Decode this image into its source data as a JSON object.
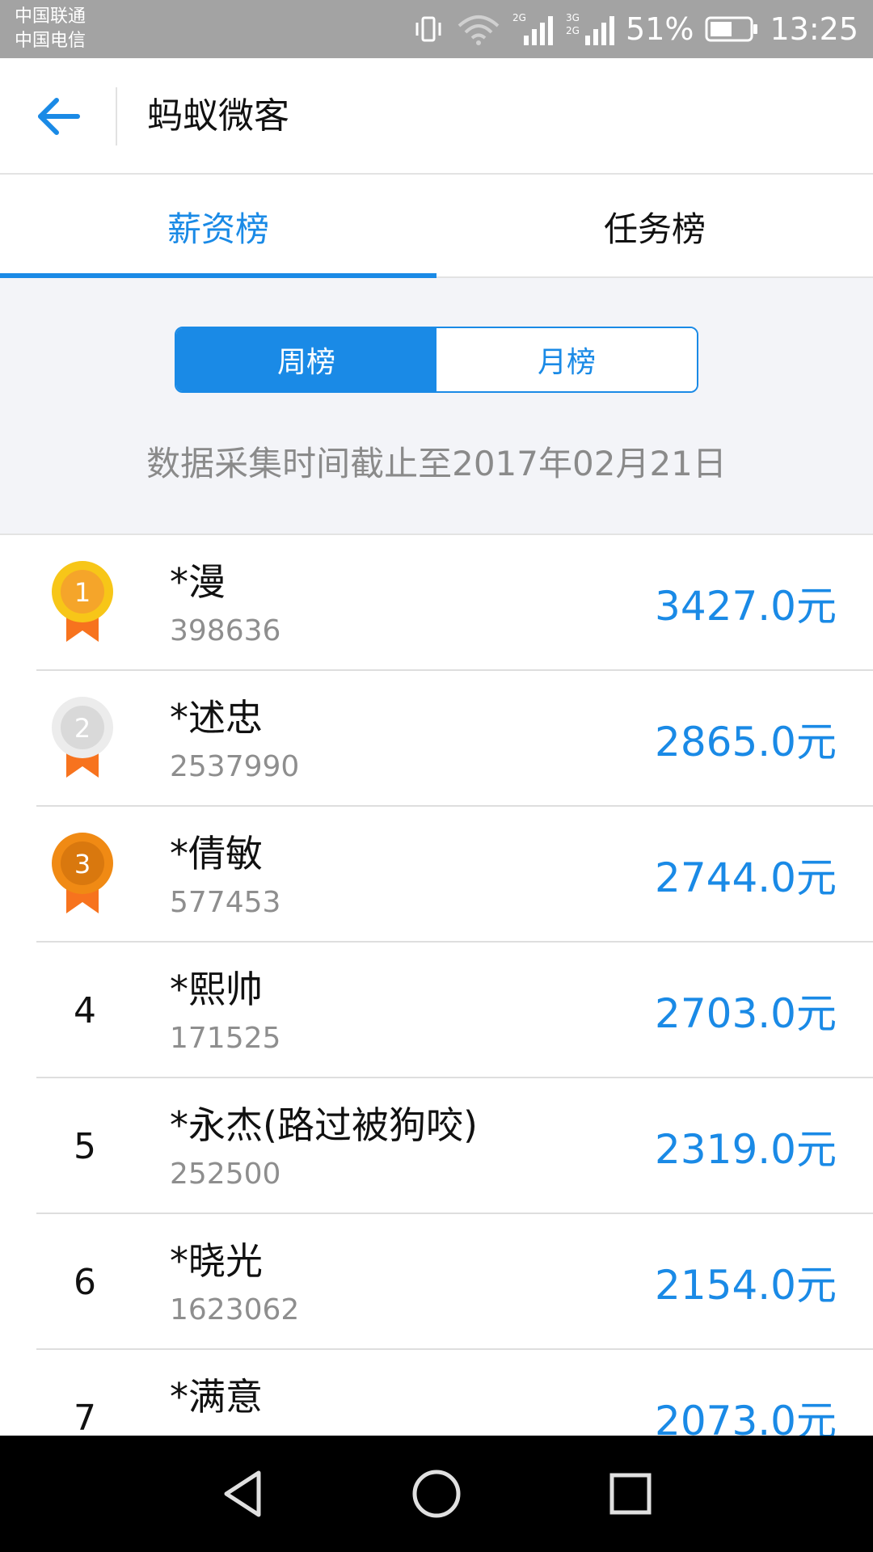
{
  "status_bar": {
    "carrier_1": "中国联通",
    "carrier_2": "中国电信",
    "battery": "51%",
    "time": "13:25",
    "icons": [
      "vibrate-icon",
      "wifi-icon",
      "signal-2g-icon",
      "signal-3g-2g-icon",
      "battery-icon"
    ]
  },
  "app_bar": {
    "title": "蚂蚁微客",
    "back_icon": "arrow-left-icon"
  },
  "tabs": [
    {
      "label": "薪资榜",
      "active": true
    },
    {
      "label": "任务榜",
      "active": false
    }
  ],
  "period_toggle": {
    "week": "周榜",
    "month": "月榜",
    "selected": "week"
  },
  "data_date": "数据采集时间截止至2017年02月21日",
  "ranking": [
    {
      "rank": "1",
      "name": "*漫",
      "id": "398636",
      "amount": "3427.0元",
      "badge": "gold-medal-icon"
    },
    {
      "rank": "2",
      "name": "*述忠",
      "id": "2537990",
      "amount": "2865.0元",
      "badge": "silver-medal-icon"
    },
    {
      "rank": "3",
      "name": "*倩敏",
      "id": "577453",
      "amount": "2744.0元",
      "badge": "bronze-medal-icon"
    },
    {
      "rank": "4",
      "name": "*熙帅",
      "id": "171525",
      "amount": "2703.0元"
    },
    {
      "rank": "5",
      "name": "*永杰(路过被狗咬)",
      "id": "252500",
      "amount": "2319.0元"
    },
    {
      "rank": "6",
      "name": "*晓光",
      "id": "1623062",
      "amount": "2154.0元"
    },
    {
      "rank": "7",
      "name": "*满意",
      "amount": "2073.0元"
    }
  ],
  "colors": {
    "accent": "#1a8ae6",
    "gold": "#f7c618",
    "silver": "#d9d9d9",
    "bronze": "#f08a14",
    "ribbon": "#f7731e"
  },
  "nav_bar": [
    "back-triangle-icon",
    "home-circle-icon",
    "recent-square-icon"
  ]
}
